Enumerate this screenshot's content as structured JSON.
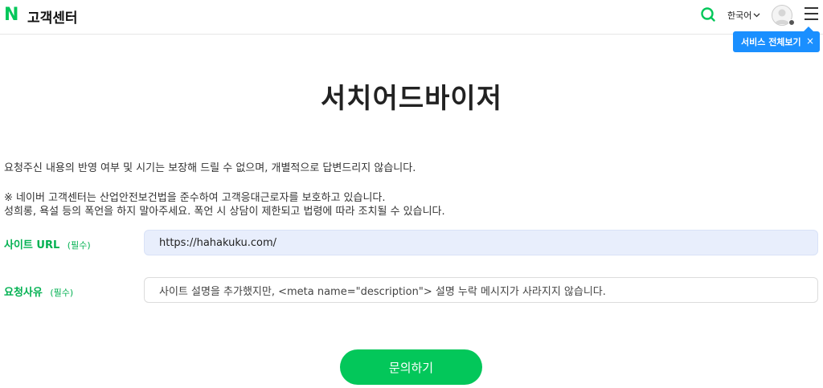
{
  "header": {
    "logo": "N",
    "brand": "고객센터",
    "language": "한국어",
    "tooltip": "서비스 전체보기",
    "tooltip_close": "×"
  },
  "title": "서치어드바이저",
  "notices": {
    "line1": "요청주신 내용의 반영 여부 및 시기는 보장해 드릴 수 없으며, 개별적으로 답변드리지 않습니다.",
    "line2": "※ 네이버 고객센터는 산업안전보건법을 준수하여 고객응대근로자를 보호하고 있습니다.",
    "line3": "성희롱, 욕설 등의 폭언을 하지 말아주세요. 폭언 시 상담이 제한되고 법령에 따라 조치될 수 있습니다."
  },
  "form": {
    "site_url_label": "사이트 URL",
    "site_url_required": "(필수)",
    "site_url_value": "https://hahakuku.com/",
    "reason_label": "요청사유",
    "reason_required": "(필수)",
    "reason_value": "사이트 설명을 추가했지만, <meta name=\"description\"> 설명 누락 메시지가 사라지지 않습니다.",
    "submit": "문의하기"
  },
  "colors": {
    "brand_green": "#03c75a",
    "tooltip_blue": "#1a8fff",
    "url_field_bg": "#e8eefc"
  }
}
